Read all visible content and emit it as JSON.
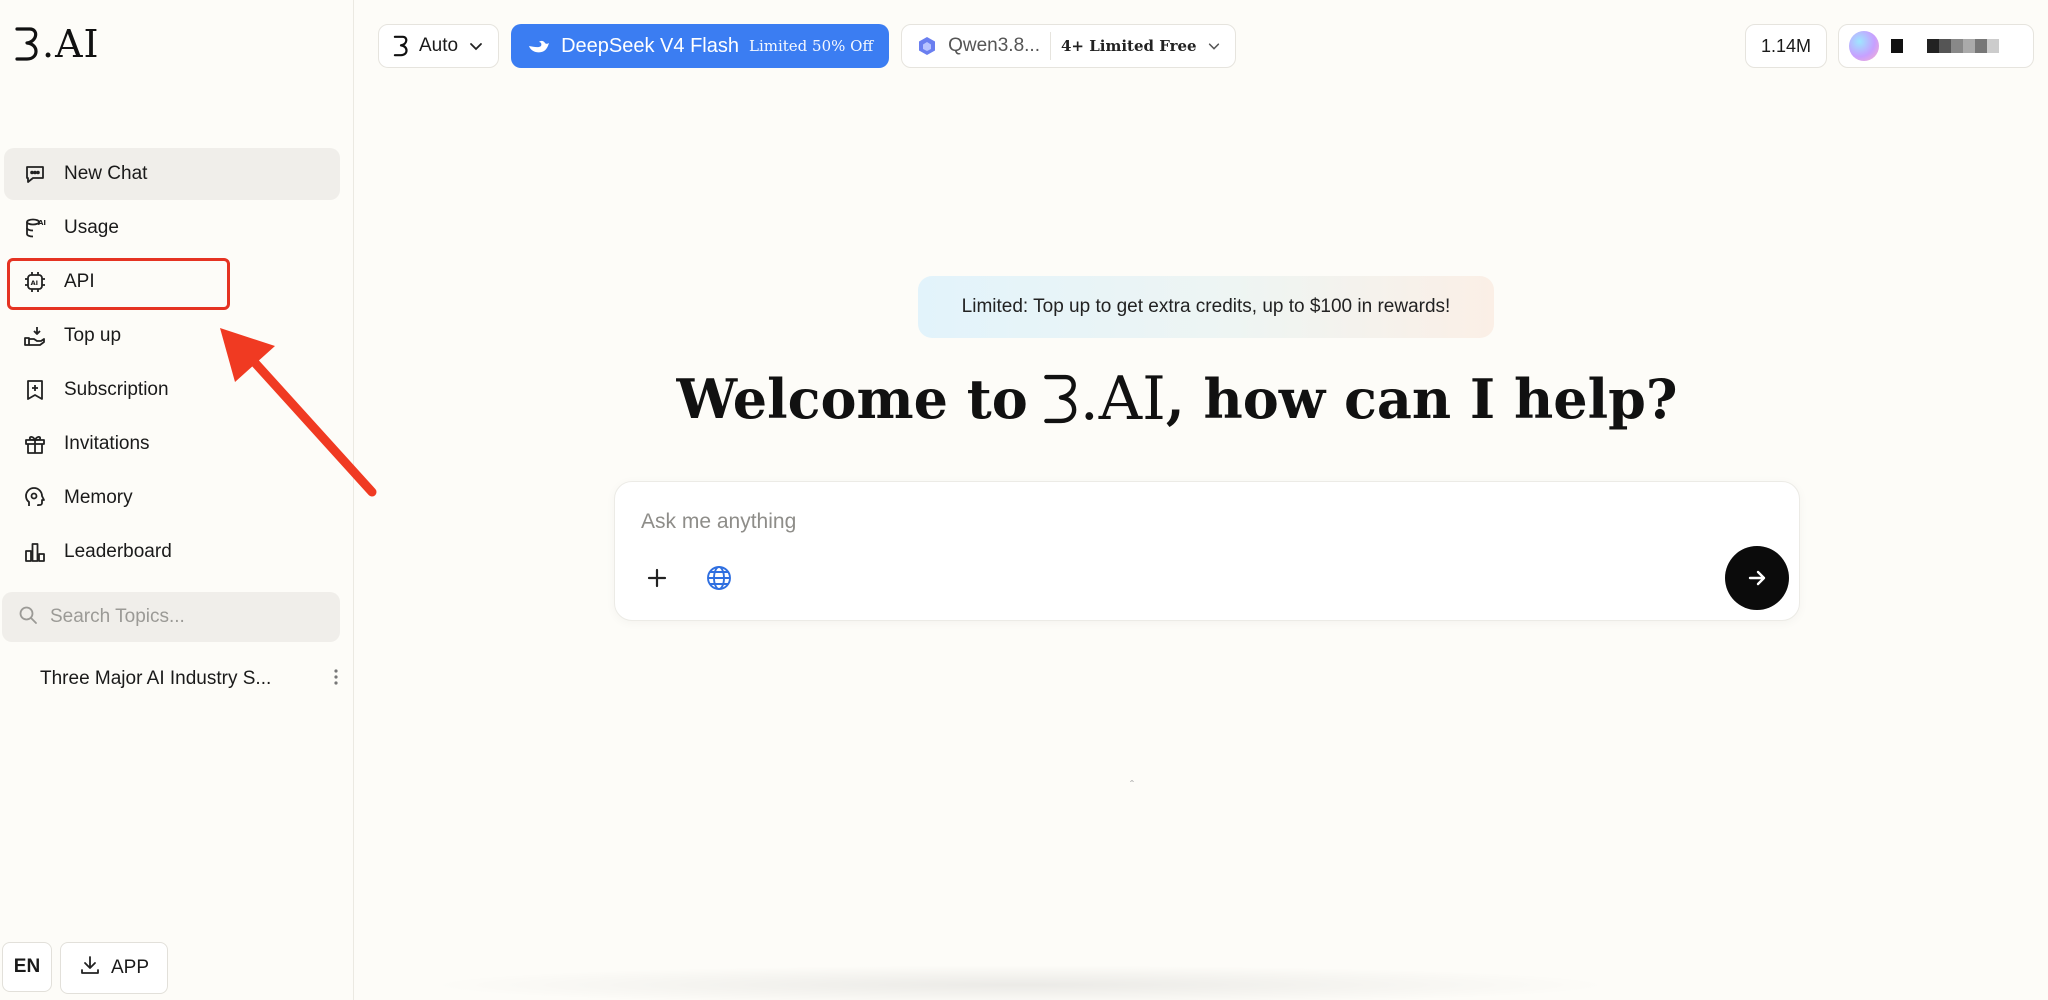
{
  "brand": {
    "name": ".AI"
  },
  "sidebar": {
    "items": [
      {
        "label": "New Chat",
        "icon": "chat-bubble-icon"
      },
      {
        "label": "Usage",
        "icon": "database-ai-icon"
      },
      {
        "label": "API",
        "icon": "ai-chip-icon"
      },
      {
        "label": "Top up",
        "icon": "hand-coin-icon"
      },
      {
        "label": "Subscription",
        "icon": "bookmark-plus-icon"
      },
      {
        "label": "Invitations",
        "icon": "gift-icon"
      },
      {
        "label": "Memory",
        "icon": "brain-head-icon"
      },
      {
        "label": "Leaderboard",
        "icon": "bar-chart-icon"
      }
    ],
    "search_placeholder": "Search Topics...",
    "topics": [
      {
        "label": "Three Major AI Industry S..."
      }
    ],
    "lang": "EN",
    "app_label": "APP"
  },
  "topbar": {
    "auto_label": "Auto",
    "model_label": "DeepSeek V4 Flash",
    "model_promo": "Limited 50% Off",
    "secondary_model": "Qwen3.8...",
    "secondary_badge": "4+ Limited Free",
    "credits": "1.14M"
  },
  "main": {
    "banner": "Limited: Top up to get extra credits, up to $100 in rewards!",
    "welcome_prefix": "Welcome to",
    "welcome_brand": ".AI",
    "welcome_suffix": ", how can I help?",
    "input_placeholder": "Ask me anything"
  },
  "colors": {
    "accent_blue": "#3b7df2",
    "highlight_red": "#e53322",
    "background": "#fdfcf8"
  }
}
